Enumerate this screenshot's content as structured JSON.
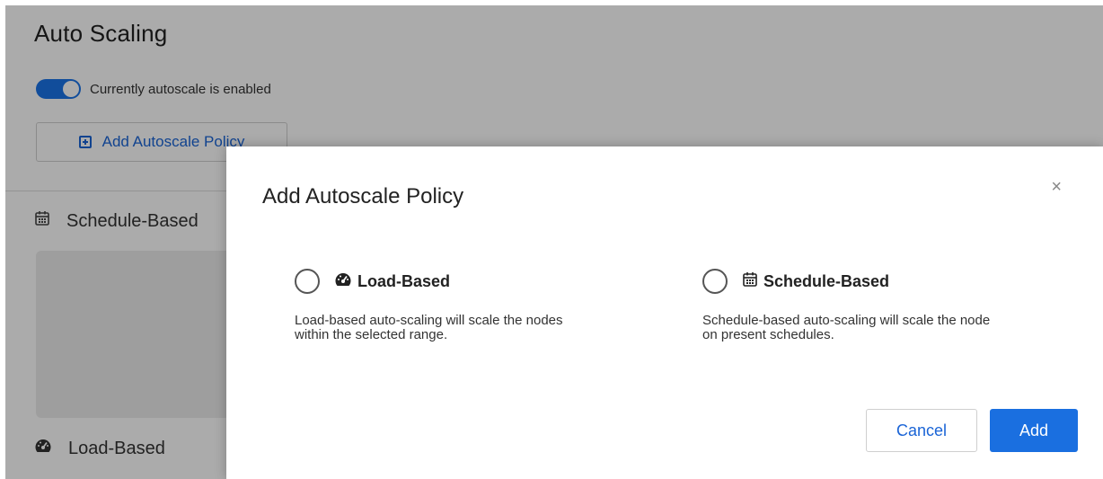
{
  "page": {
    "title": "Auto Scaling",
    "autoscale_toggle": {
      "enabled": true,
      "label": "Currently autoscale is enabled"
    },
    "add_policy_button": "Add Autoscale Policy",
    "sections": [
      {
        "label": "Schedule-Based",
        "icon": "calendar-icon"
      },
      {
        "label": "Load-Based",
        "icon": "gauge-icon"
      }
    ]
  },
  "modal": {
    "title": "Add Autoscale Policy",
    "close_label": "×",
    "options": [
      {
        "icon": "gauge-icon",
        "title": "Load-Based",
        "desc_line1": "Load-based auto-scaling will scale the nodes",
        "desc_line2": "within the selected range."
      },
      {
        "icon": "calendar-icon",
        "title": "Schedule-Based",
        "desc_line1": "Schedule-based auto-scaling will scale the node",
        "desc_line2": "on present schedules."
      }
    ],
    "cancel_label": "Cancel",
    "add_label": "Add"
  },
  "colors": {
    "accent": "#1a73e8",
    "primary_button": "#1a6fe0",
    "overlay": "rgba(0,0,0,0.33)"
  }
}
